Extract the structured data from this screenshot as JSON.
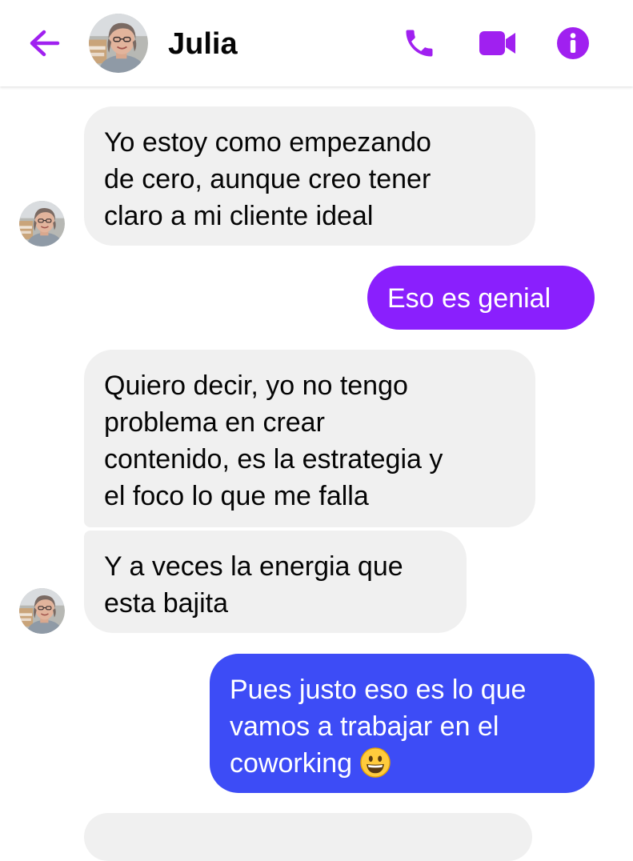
{
  "header": {
    "contact_name": "Julia",
    "back_icon": "arrow-left-icon",
    "phone_icon": "phone-icon",
    "video_icon": "video-camera-icon",
    "info_icon": "info-icon",
    "accent_color": "#a020f0"
  },
  "messages": [
    {
      "sender": "Julia",
      "direction": "incoming",
      "text": "Yo estoy como empezando\nde cero, aunque creo tener\nclaro a mi cliente ideal"
    },
    {
      "sender": "me",
      "direction": "outgoing",
      "text": "Eso es genial"
    },
    {
      "sender": "Julia",
      "direction": "incoming",
      "text": "Quiero decir, yo no tengo\nproblema en crear\ncontenido, es la estrategia y\nel foco lo que me falla"
    },
    {
      "sender": "Julia",
      "direction": "incoming",
      "text": "Y a veces la energia que\nesta bajita"
    },
    {
      "sender": "me",
      "direction": "outgoing",
      "text": "Pues justo eso es lo que\nvamos a trabajar en el\ncoworking ",
      "emoji": "grinning-face-emoji"
    },
    {
      "sender": "Julia",
      "direction": "incoming",
      "text": ""
    }
  ],
  "colors": {
    "incoming_bubble": "#f0f0f0",
    "outgoing_gradient_top": "#8a1ffd",
    "outgoing_gradient_bottom": "#3d4cf6"
  }
}
